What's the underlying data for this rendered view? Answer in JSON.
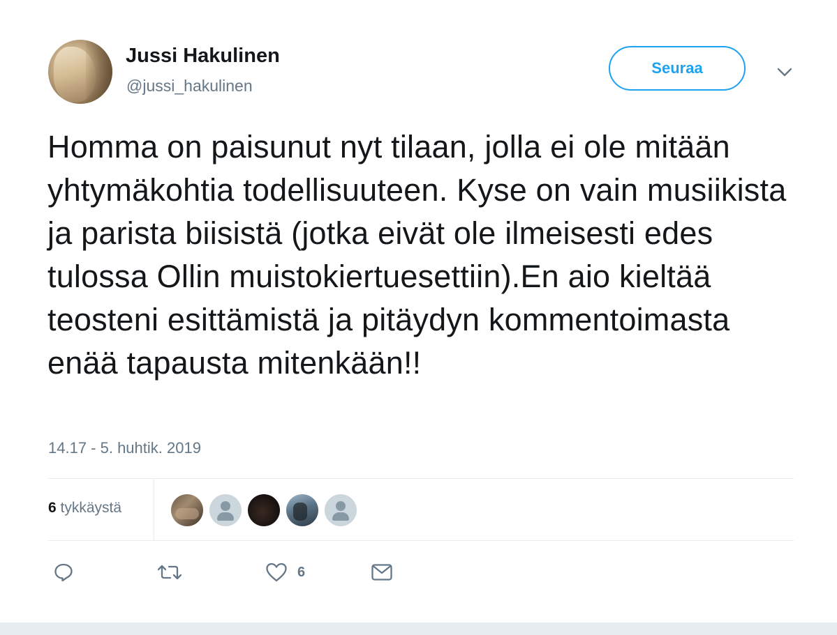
{
  "author": {
    "display_name": "Jussi Hakulinen",
    "handle": "@jussi_hakulinen"
  },
  "follow_button": {
    "label": "Seuraa"
  },
  "tweet": {
    "text": "Homma on paisunut nyt tilaan, jolla ei ole mitään yhtymäkohtia todellisuuteen. Kyse on vain musiikista ja parista biisistä (jotka eivät ole ilmeisesti edes tulossa Ollin muistokiertuesettiin).En aio kieltää teosteni esittämistä ja pitäydyn kommentoimasta enää tapausta mitenkään!!",
    "timestamp": "14.17 - 5. huhtik. 2019"
  },
  "stats": {
    "likes_count": "6",
    "likes_label": "tykkäystä"
  },
  "likers": [
    {
      "kind": "photo"
    },
    {
      "kind": "default"
    },
    {
      "kind": "photo"
    },
    {
      "kind": "photo"
    },
    {
      "kind": "default"
    }
  ],
  "actions": {
    "reply_icon": "reply-icon",
    "retweet_icon": "retweet-icon",
    "like_icon": "heart-icon",
    "like_count": "6",
    "message_icon": "envelope-icon"
  },
  "colors": {
    "accent": "#1da1f2",
    "text": "#14171a",
    "secondary": "#657786",
    "divider": "#e6ecf0"
  }
}
